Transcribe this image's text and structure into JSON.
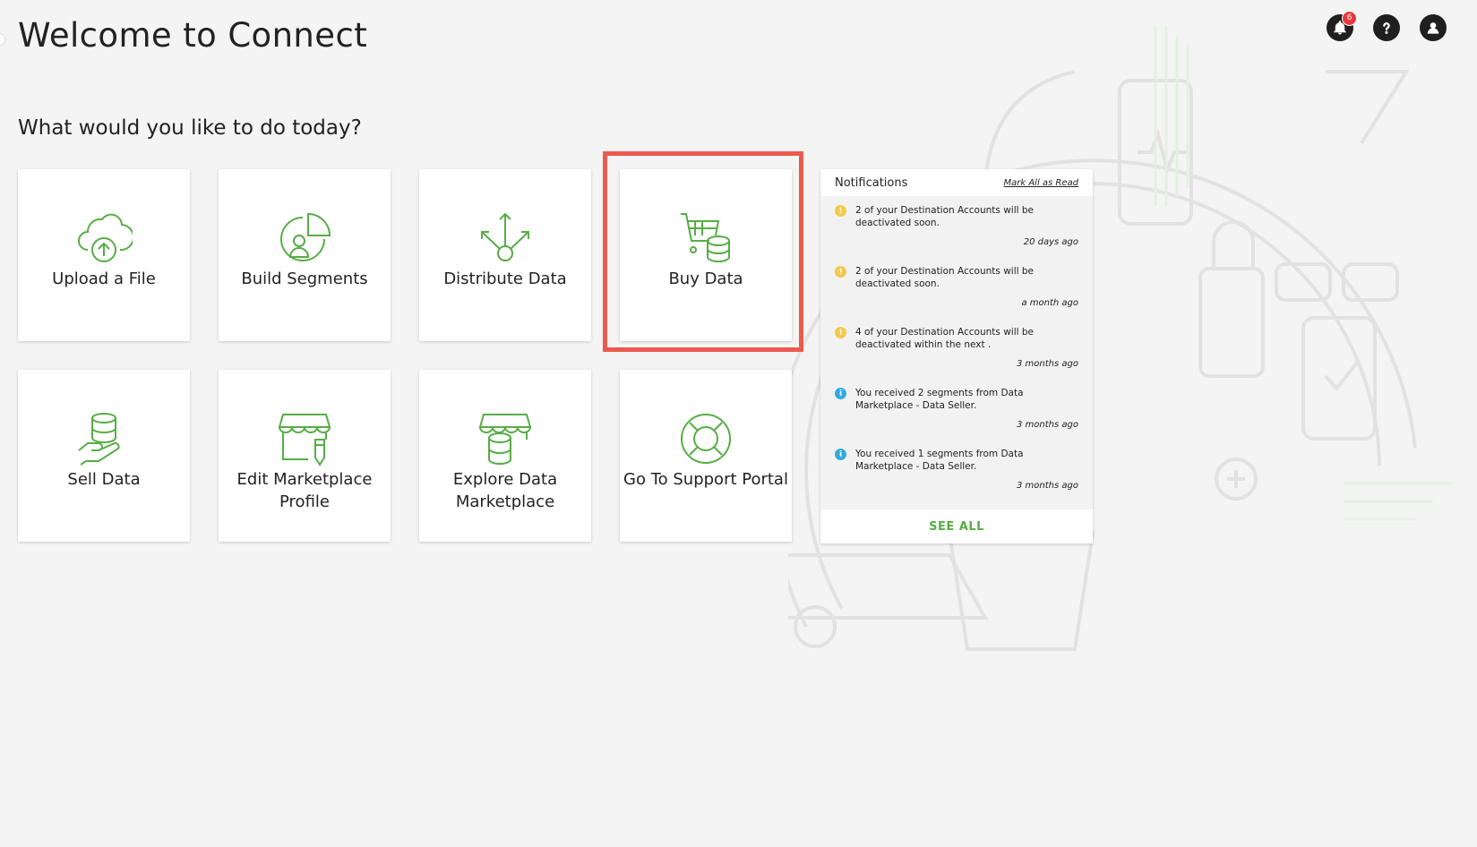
{
  "header": {
    "title": "Welcome to Connect"
  },
  "main": {
    "subtitle": "What would you like to do today?"
  },
  "top_icons": {
    "notification_count": "6"
  },
  "tiles": [
    {
      "label": "Upload a File",
      "icon": "cloud-upload-icon"
    },
    {
      "label": "Build Segments",
      "icon": "segment-icon"
    },
    {
      "label": "Distribute Data",
      "icon": "distribute-icon"
    },
    {
      "label": "Buy Data",
      "icon": "cart-database-icon"
    },
    {
      "label": "Sell Data",
      "icon": "hand-database-icon"
    },
    {
      "label": "Edit Marketplace Profile",
      "icon": "storefront-edit-icon"
    },
    {
      "label": "Explore Data Marketplace",
      "icon": "storefront-database-icon"
    },
    {
      "label": "Go To Support Portal",
      "icon": "lifebuoy-icon"
    }
  ],
  "notifications": {
    "title": "Notifications",
    "mark_all": "Mark All as Read",
    "see_all": "SEE ALL",
    "items": [
      {
        "type": "warning",
        "text": "2 of your Destination Accounts will be deactivated soon.",
        "time": "20 days ago"
      },
      {
        "type": "warning",
        "text": "2 of your Destination Accounts will be deactivated soon.",
        "time": "a month ago"
      },
      {
        "type": "warning",
        "text": "4 of your Destination Accounts will be deactivated within the next .",
        "time": "3 months ago"
      },
      {
        "type": "info",
        "text": "You received 2 segments from Data Marketplace - Data Seller.",
        "time": "3 months ago"
      },
      {
        "type": "info",
        "text": "You received 1 segments from Data Marketplace - Data Seller.",
        "time": "3 months ago"
      }
    ]
  },
  "colors": {
    "accent": "#57ad45",
    "highlight": "#ec5a4e",
    "warning": "#f5c94c",
    "info": "#34a9e1",
    "badge": "#e8383d"
  }
}
